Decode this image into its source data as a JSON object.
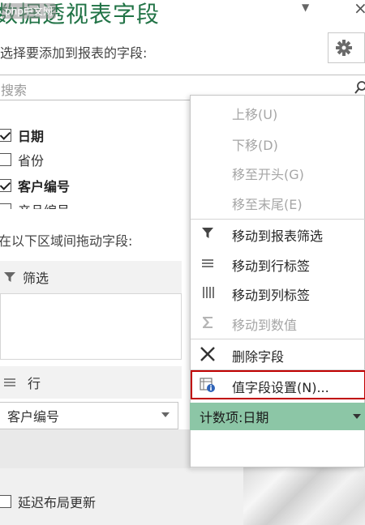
{
  "header": {
    "title": "数据透视表字段",
    "watermark": "php中文网",
    "subtitle": "选择要添加到报表的字段:"
  },
  "search": {
    "placeholder": "搜索"
  },
  "fields": [
    {
      "label": "日期",
      "checked": true,
      "bold": true
    },
    {
      "label": "省份",
      "checked": false,
      "bold": false
    },
    {
      "label": "客户编号",
      "checked": true,
      "bold": true
    },
    {
      "label": "产品编号",
      "checked": false,
      "bold": false
    }
  ],
  "drag_hint": "在以下区域间拖动字段:",
  "areas": {
    "filter_label": "筛选",
    "rows_label": "行",
    "rows_item": "客户编号"
  },
  "context_menu": {
    "items": [
      {
        "label": "上移(U)",
        "disabled": true,
        "icon": "none"
      },
      {
        "label": "下移(D)",
        "disabled": true,
        "icon": "none"
      },
      {
        "label": "移至开头(G)",
        "disabled": true,
        "icon": "none"
      },
      {
        "label": "移至末尾(E)",
        "disabled": true,
        "icon": "none"
      },
      {
        "label": "移动到报表筛选",
        "disabled": false,
        "icon": "filter-icon"
      },
      {
        "label": "移动到行标签",
        "disabled": false,
        "icon": "rows-icon"
      },
      {
        "label": "移动到列标签",
        "disabled": false,
        "icon": "columns-icon"
      },
      {
        "label": "移动到数值",
        "disabled": true,
        "icon": "sigma-icon"
      },
      {
        "label": "删除字段",
        "disabled": false,
        "icon": "delete-x-icon"
      },
      {
        "label": "值字段设置(N)...",
        "disabled": false,
        "icon": "value-field-settings-icon"
      }
    ],
    "highlight_color": "#c00000"
  },
  "values_item": "计数项:日期",
  "defer_label": "延迟布局更新",
  "colors": {
    "title": "#217346",
    "values_item_bg": "#8cc6a6",
    "disabled_text": "#a6a6a6"
  }
}
